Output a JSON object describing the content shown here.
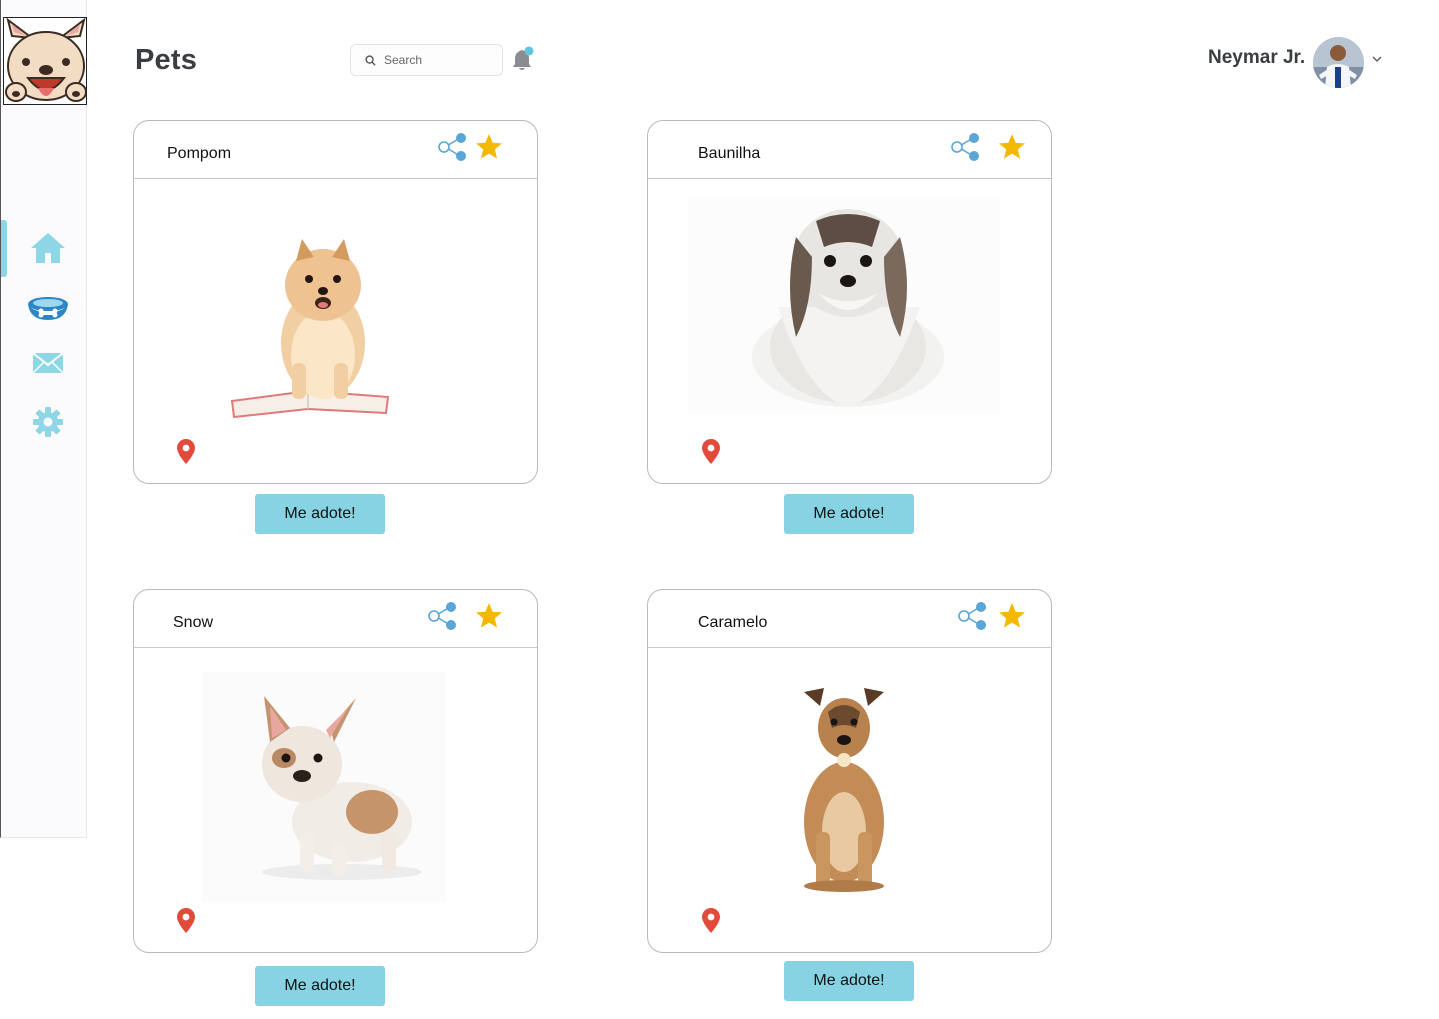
{
  "header": {
    "title": "Pets",
    "search_placeholder": "Search",
    "user_name": "Neymar Jr."
  },
  "sidebar": {
    "items": [
      {
        "icon": "home-icon",
        "active": true
      },
      {
        "icon": "pet-bowl-icon",
        "active": false
      },
      {
        "icon": "mail-icon",
        "active": false
      },
      {
        "icon": "gear-icon",
        "active": false
      }
    ]
  },
  "pets": [
    {
      "name": "Pompom",
      "button": "Me adote!"
    },
    {
      "name": "Baunilha",
      "button": "Me adote!"
    },
    {
      "name": "Snow",
      "button": "Me adote!"
    },
    {
      "name": "Caramelo",
      "button": "Me adote!"
    }
  ],
  "colors": {
    "accent": "#87d3e4",
    "share": "#5aa6d6",
    "star": "#f5b800",
    "pin": "#e24b3b",
    "nav_icon": "#8dd6e6"
  }
}
